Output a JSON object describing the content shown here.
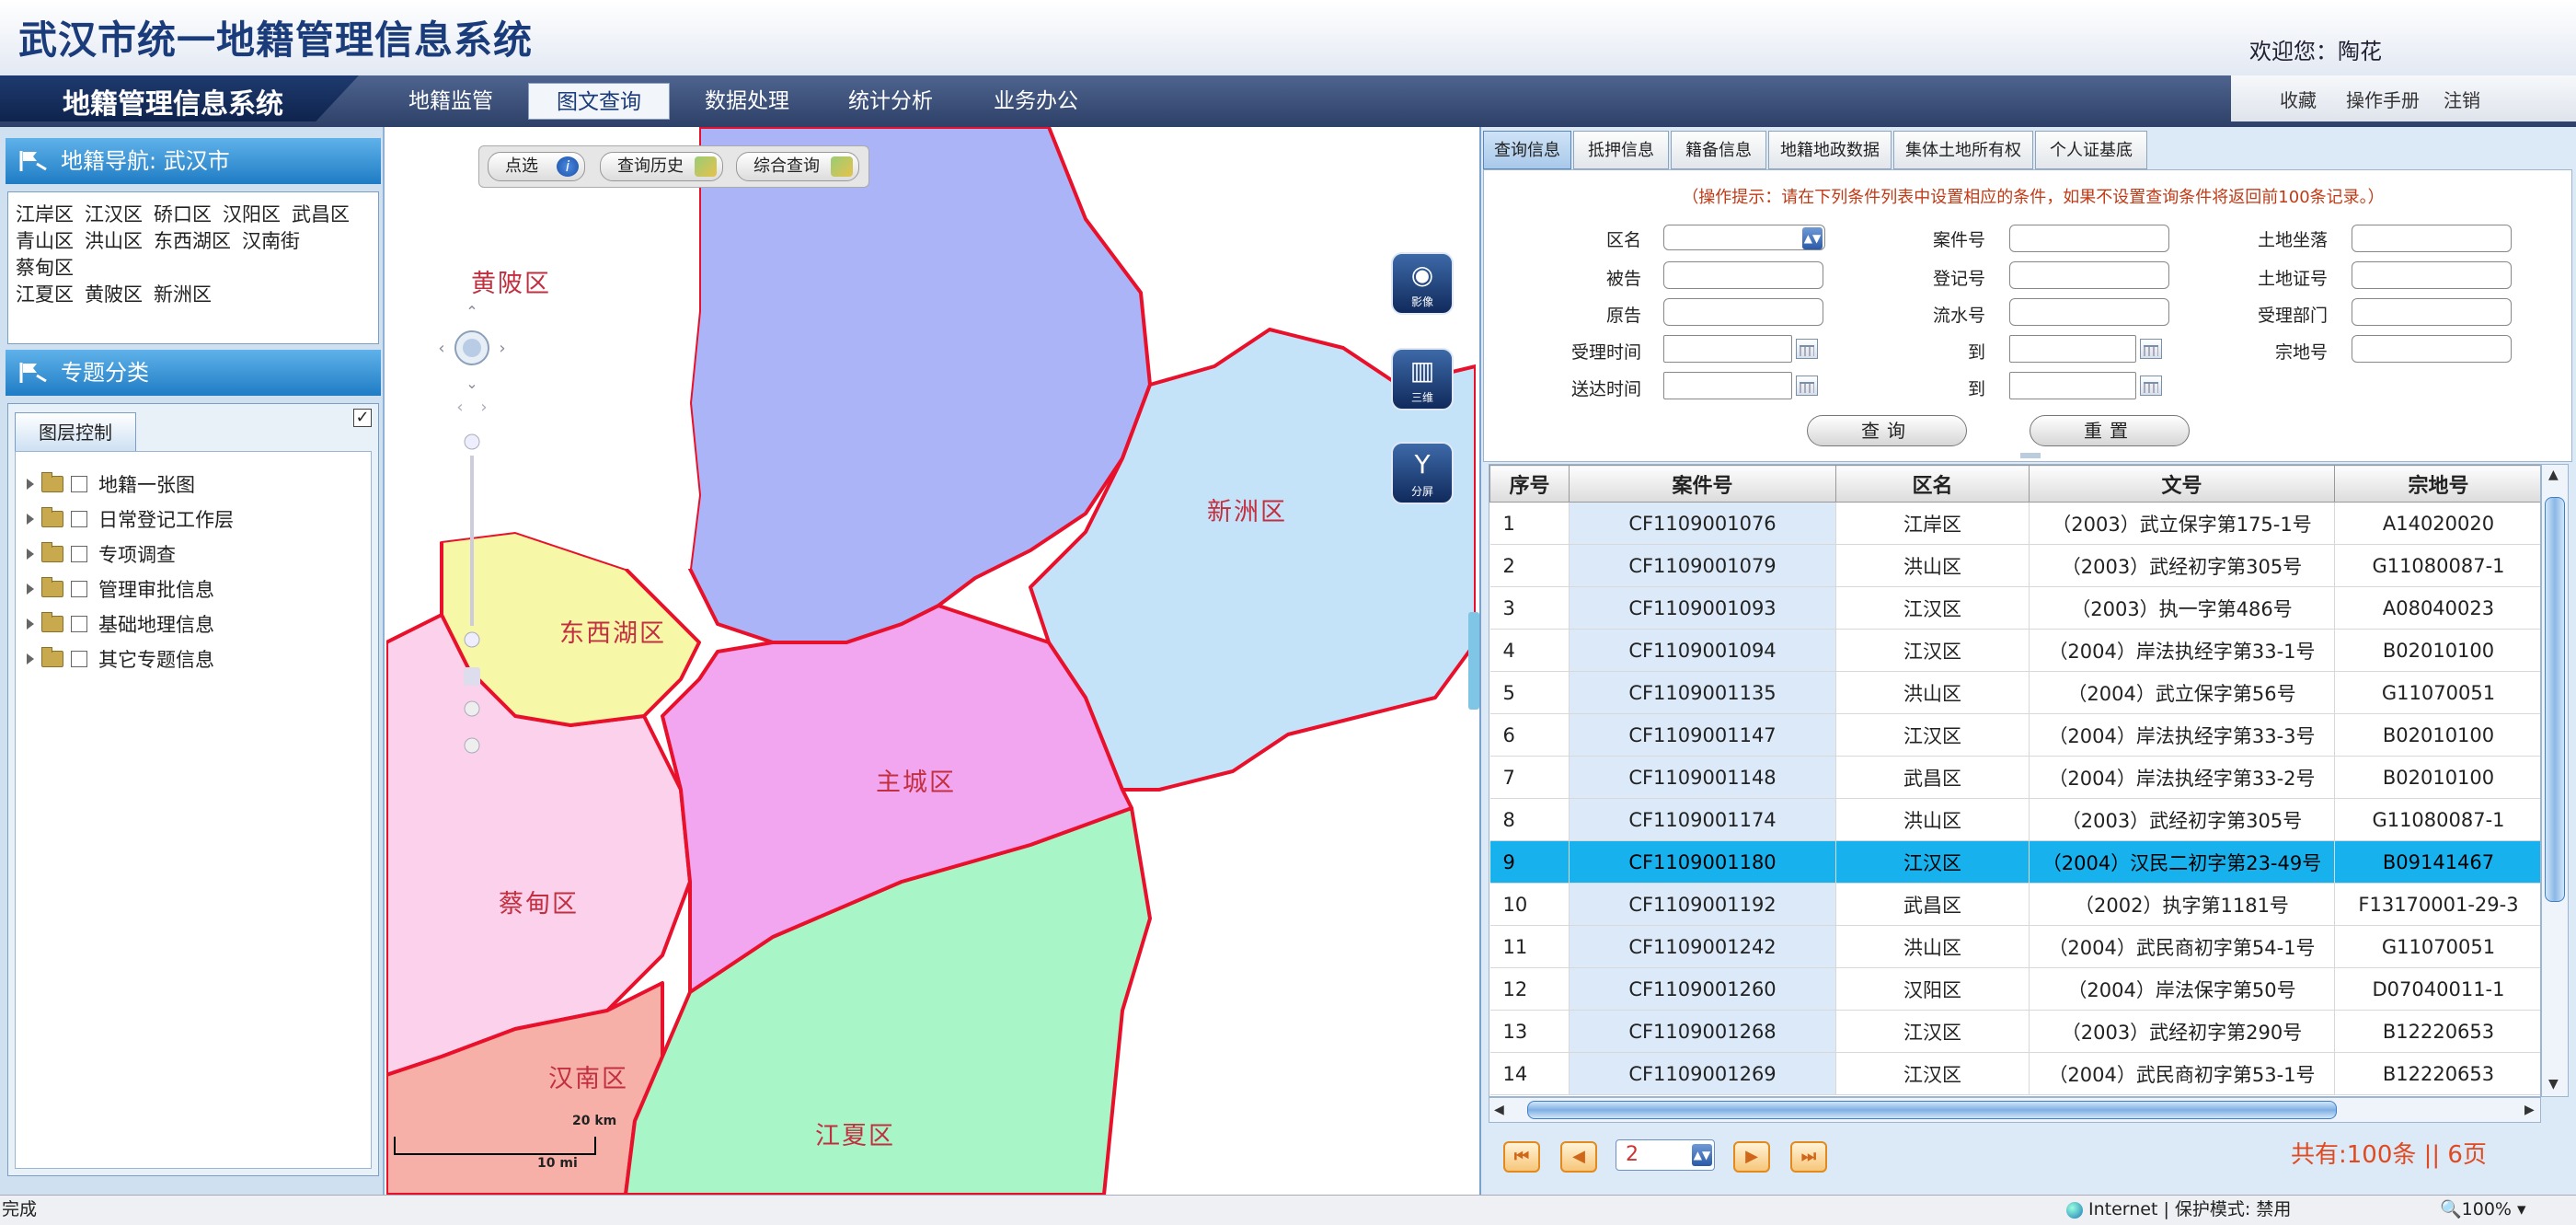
{
  "header": {
    "title": "武汉市统一地籍管理信息系统",
    "welcome": "欢迎您：陶花"
  },
  "nav": {
    "system_name": "地籍管理信息系统",
    "tabs": [
      {
        "label": "地籍监管"
      },
      {
        "label": "图文查询",
        "active": true
      },
      {
        "label": "数据处理"
      },
      {
        "label": "统计分析"
      },
      {
        "label": "业务办公"
      }
    ],
    "utility": [
      "收藏",
      "操作手册",
      "注销"
    ]
  },
  "left": {
    "nav_title": "地籍导航: 武汉市",
    "districts": [
      "江岸区",
      "江汉区",
      "硚口区",
      "汉阳区",
      "武昌区",
      "青山区",
      "洪山区",
      "东西湖区",
      "汉南街",
      "蔡甸区",
      "江夏区",
      "黄陂区",
      "新洲区"
    ],
    "theme_title": "专题分类",
    "layer_tab": "图层控制",
    "all_checked": "✓",
    "tree": [
      "地籍一张图",
      "日常登记工作层",
      "专项调查",
      "管理审批信息",
      "基础地理信息",
      "其它专题信息"
    ]
  },
  "map": {
    "tools": [
      {
        "label": "点选",
        "icon": "info-icon"
      },
      {
        "label": "查询历史",
        "icon": "history-icon"
      },
      {
        "label": "综合查询",
        "icon": "query-icon"
      }
    ],
    "side_buttons": [
      {
        "label": "影像",
        "icon": "globe-icon"
      },
      {
        "label": "三维",
        "icon": "buildings-icon"
      },
      {
        "label": "分屏",
        "icon": "split-icon"
      }
    ],
    "regions": [
      "黄陂区",
      "新洲区",
      "东西湖区",
      "主城区",
      "蔡甸区",
      "汉南区",
      "江夏区"
    ],
    "scale": {
      "km": "20 km",
      "mi": "10 mi"
    },
    "colors": {
      "huangpi": "#aab4f7",
      "xinzhou": "#c4e2f8",
      "dongxihu": "#f7f7a8",
      "zhucheng": "#f3a6f0",
      "caidian": "#fbd1ec",
      "hannan": "#f7b0a8",
      "jiangxia": "#a8f5c8",
      "border": "#e8102a"
    }
  },
  "right": {
    "tabs": [
      {
        "label": "查询信息",
        "active": true
      },
      {
        "label": "抵押信息"
      },
      {
        "label": "籍备信息"
      },
      {
        "label": "地籍地政数据"
      },
      {
        "label": "集体土地所有权"
      },
      {
        "label": "个人证基底"
      }
    ],
    "hint": "（操作提示：请在下列条件列表中设置相应的条件，如果不设置查询条件将返回前100条记录。）",
    "form": {
      "district_label": "区名",
      "district_value": "",
      "case_label": "案件号",
      "location_label": "土地坐落",
      "defendant_label": "被告",
      "regno_label": "登记号",
      "certno_label": "土地证号",
      "plaintiff_label": "原告",
      "serial_label": "流水号",
      "dept_label": "受理部门",
      "accept_label": "受理时间",
      "to_label": "到",
      "parcel_label": "宗地号",
      "deliver_label": "送达时间",
      "query_btn": "查询",
      "reset_btn": "重置"
    },
    "columns": [
      "序号",
      "案件号",
      "区名",
      "文号",
      "宗地号"
    ],
    "rows": [
      [
        "1",
        "CF1109001076",
        "江岸区",
        "（2003）武立保字第175-1号",
        "A14020020"
      ],
      [
        "2",
        "CF1109001079",
        "洪山区",
        "（2003）武经初字第305号",
        "G11080087-1"
      ],
      [
        "3",
        "CF1109001093",
        "江汉区",
        "（2003）执一字第486号",
        "A08040023"
      ],
      [
        "4",
        "CF1109001094",
        "江汉区",
        "（2004）岸法执经字第33-1号",
        "B02010100"
      ],
      [
        "5",
        "CF1109001135",
        "洪山区",
        "（2004）武立保字第56号",
        "G11070051"
      ],
      [
        "6",
        "CF1109001147",
        "江汉区",
        "（2004）岸法执经字第33-3号",
        "B02010100"
      ],
      [
        "7",
        "CF1109001148",
        "武昌区",
        "（2004）岸法执经字第33-2号",
        "B02010100"
      ],
      [
        "8",
        "CF1109001174",
        "洪山区",
        "（2003）武经初字第305号",
        "G11080087-1"
      ],
      [
        "9",
        "CF1109001180",
        "江汉区",
        "（2004）汉民二初字第23-49号",
        "B09141467"
      ],
      [
        "10",
        "CF1109001192",
        "武昌区",
        "（2002）执字第1181号",
        "F13170001-29-3"
      ],
      [
        "11",
        "CF1109001242",
        "洪山区",
        "（2004）武民商初字第54-1号",
        "G11070051"
      ],
      [
        "12",
        "CF1109001260",
        "汉阳区",
        "（2004）岸法保字第50号",
        "D07040011-1"
      ],
      [
        "13",
        "CF1109001268",
        "江汉区",
        "（2003）武经初字第290号",
        "B12220653"
      ],
      [
        "14",
        "CF1109001269",
        "江汉区",
        "（2004）武民商初字第53-1号",
        "B12220653"
      ]
    ],
    "selected_row": 9,
    "pager": {
      "page": "2",
      "total": "共有:100条 || 6页"
    }
  },
  "status": {
    "left": "完成",
    "zone": "Internet | 保护模式: 禁用",
    "zoom": "100%"
  }
}
